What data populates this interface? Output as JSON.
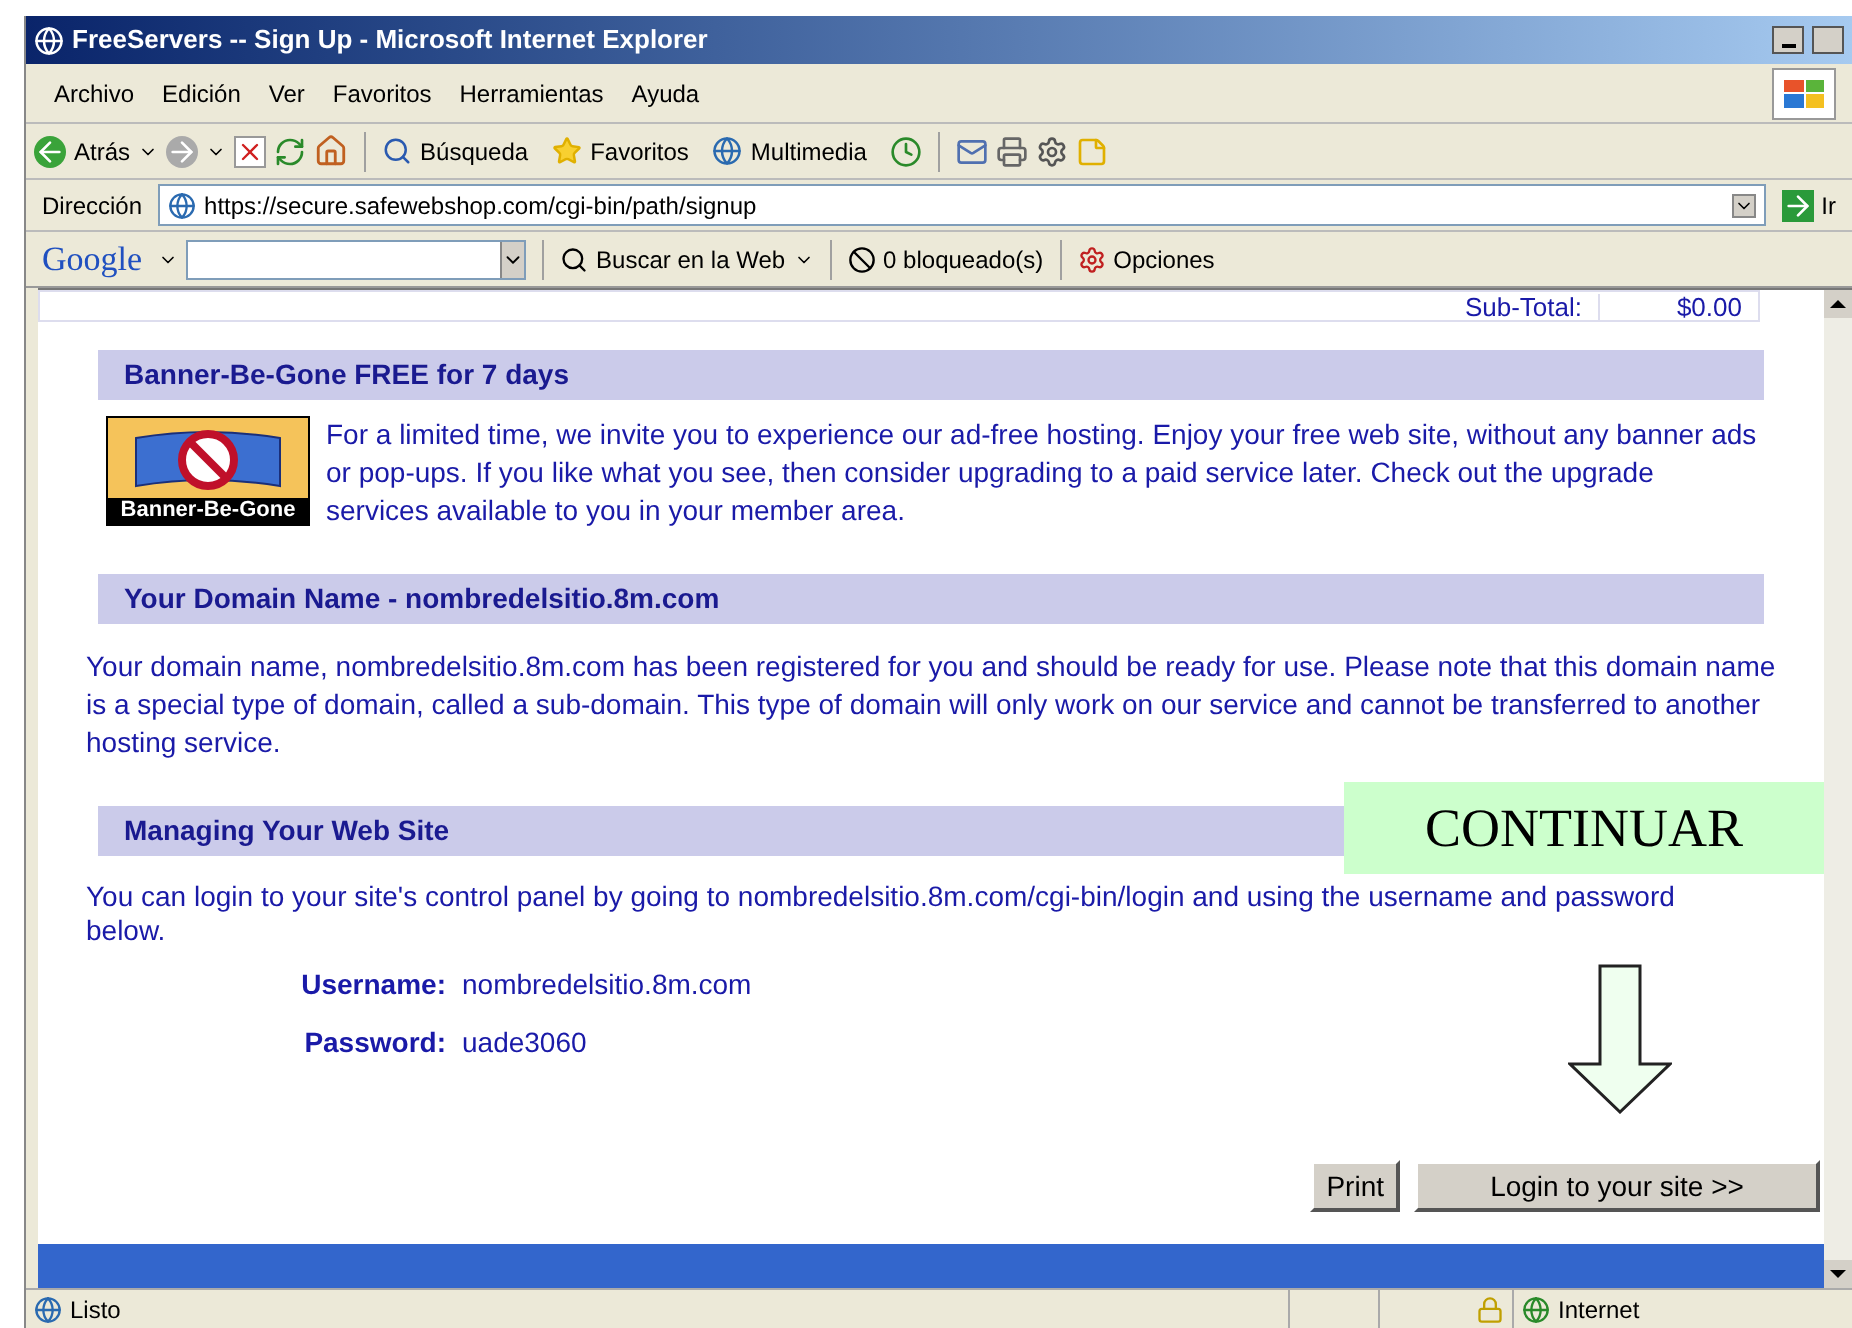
{
  "window": {
    "title": "FreeServers -- Sign Up - Microsoft Internet Explorer"
  },
  "menu": [
    "Archivo",
    "Edición",
    "Ver",
    "Favoritos",
    "Herramientas",
    "Ayuda"
  ],
  "toolbar": {
    "back": "Atrás",
    "search": "Búsqueda",
    "favorites": "Favoritos",
    "media": "Multimedia"
  },
  "address_bar": {
    "label": "Dirección",
    "value": "https://secure.safewebshop.com/cgi-bin/path/signup",
    "go": "Ir"
  },
  "google_bar": {
    "logo": "Google",
    "search_web": "Buscar en la Web",
    "blocked": "0 bloqueado(s)",
    "options": "Opciones"
  },
  "subtotal": {
    "label": "Sub-Total:",
    "value": "$0.00"
  },
  "sections": [
    {
      "heading": "Banner-Be-Gone FREE for 7 days",
      "kind": "banner",
      "logo_text": "Banner-Be-Gone",
      "body": "For a limited time, we invite you to experience our ad-free hosting. Enjoy your free web site, without any banner ads or pop-ups. If you like what you see, then consider upgrading to a paid service later. Check out the upgrade services available to you in your member area."
    },
    {
      "heading": "Your Domain Name - nombredelsitio.8m.com",
      "kind": "text",
      "body": "Your domain name, nombredelsitio.8m.com has been registered for you and should be ready for use. Please note that this domain name is a special type of domain, called a sub-domain. This type of domain will only work on our service and cannot be transferred to another hosting service."
    },
    {
      "heading": "Managing Your Web Site",
      "kind": "login",
      "body": "You can login to your site's control panel by going to nombredelsitio.8m.com/cgi-bin/login and using the username and password below.",
      "fields": [
        {
          "label": "Username:",
          "value": "nombredelsitio.8m.com"
        },
        {
          "label": "Password:",
          "value": "uade3060"
        }
      ]
    }
  ],
  "buttons": [
    "Print",
    "Login to your site >>"
  ],
  "annotation": {
    "label": "CONTINUAR"
  },
  "status_bar": {
    "text": "Listo",
    "zone": "Internet"
  }
}
